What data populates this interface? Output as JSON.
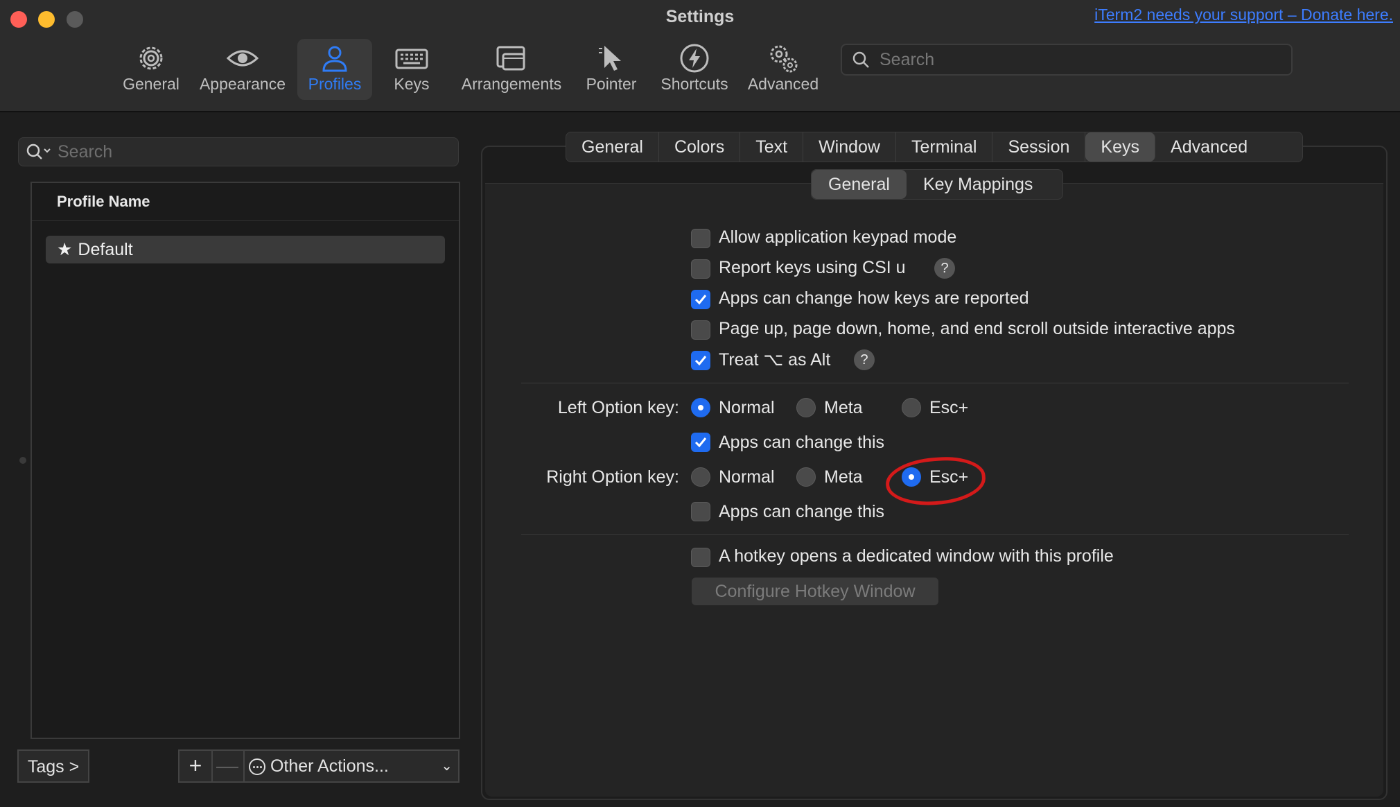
{
  "window": {
    "title": "Settings",
    "donate_link": "iTerm2 needs your support – Donate here."
  },
  "toolbar": {
    "items": [
      {
        "label": "General",
        "icon": "gear-icon"
      },
      {
        "label": "Appearance",
        "icon": "eye-icon"
      },
      {
        "label": "Profiles",
        "icon": "person-icon",
        "active": true
      },
      {
        "label": "Keys",
        "icon": "keyboard-icon"
      },
      {
        "label": "Arrangements",
        "icon": "windows-icon"
      },
      {
        "label": "Pointer",
        "icon": "pointer-icon"
      },
      {
        "label": "Shortcuts",
        "icon": "bolt-icon"
      },
      {
        "label": "Advanced",
        "icon": "gears-icon"
      }
    ],
    "search_placeholder": "Search"
  },
  "profiles": {
    "search_placeholder": "Search",
    "column_header": "Profile Name",
    "items": [
      {
        "name": "Default",
        "icon": "star-icon"
      }
    ],
    "tags_button": "Tags >",
    "add_button": "+",
    "remove_button": "—",
    "other_actions": "Other Actions..."
  },
  "tabs": {
    "items": [
      "General",
      "Colors",
      "Text",
      "Window",
      "Terminal",
      "Session",
      "Keys",
      "Advanced"
    ],
    "active": "Keys"
  },
  "subtabs": {
    "items": [
      "General",
      "Key Mappings"
    ],
    "active": "General"
  },
  "keys_general": {
    "checkboxes": [
      {
        "label": "Allow application keypad mode",
        "checked": false
      },
      {
        "label": "Report keys using CSI u",
        "checked": false,
        "help": "?"
      },
      {
        "label": "Apps can change how keys are reported",
        "checked": true
      },
      {
        "label": "Page up, page down, home, and end scroll outside interactive apps",
        "checked": false
      },
      {
        "label": "Treat ⌥ as Alt",
        "checked": true,
        "help": "?"
      }
    ],
    "left_option": {
      "label": "Left Option key:",
      "options": [
        "Normal",
        "Meta",
        "Esc+"
      ],
      "selected": "Normal",
      "apps_can_change": {
        "label": "Apps can change this",
        "checked": true
      }
    },
    "right_option": {
      "label": "Right Option key:",
      "options": [
        "Normal",
        "Meta",
        "Esc+"
      ],
      "selected": "Esc+",
      "apps_can_change": {
        "label": "Apps can change this",
        "checked": false
      }
    },
    "hotkey": {
      "label": "A hotkey opens a dedicated window with this profile",
      "checked": false
    },
    "configure_hotkey_button": "Configure Hotkey Window"
  },
  "colors": {
    "accent": "#1f6bf0",
    "active_toolbar_label": "#2f7cf6",
    "link": "#3d7dff",
    "annotation": "#d41a1a"
  }
}
